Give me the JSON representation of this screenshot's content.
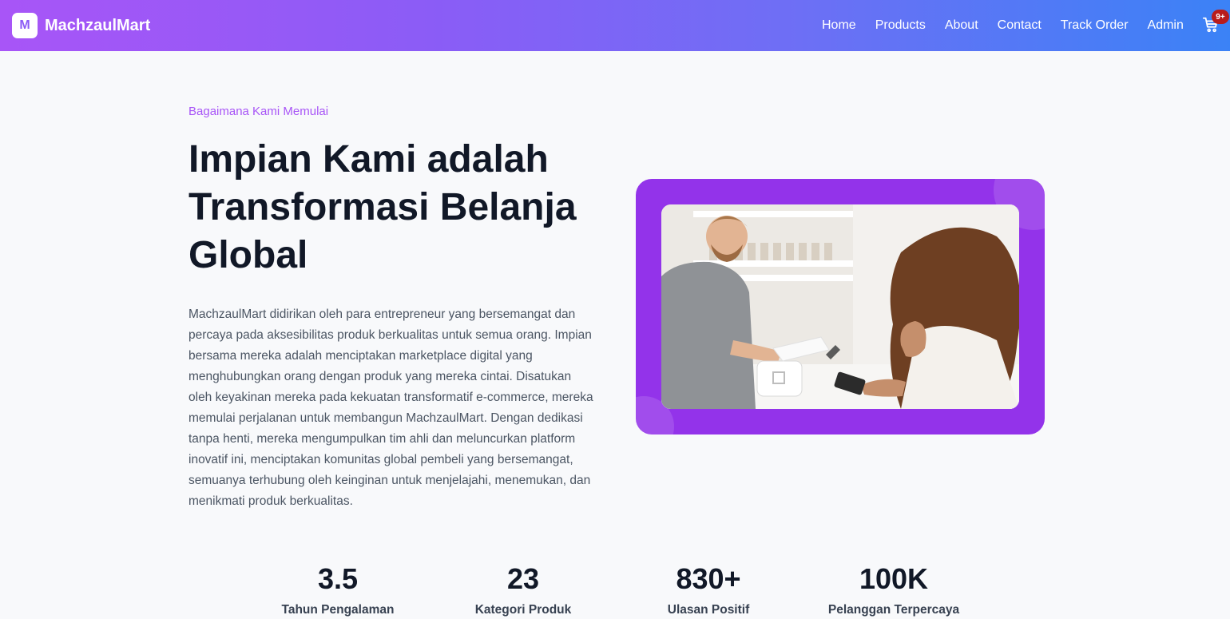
{
  "navbar": {
    "logo_letter": "M",
    "brand_name": "MachzaulMart",
    "links": [
      {
        "label": "Home"
      },
      {
        "label": "Products"
      },
      {
        "label": "About"
      },
      {
        "label": "Contact"
      },
      {
        "label": "Track Order"
      },
      {
        "label": "Admin"
      }
    ],
    "cart_icon": "cart-icon",
    "cart_badge": "9+"
  },
  "hero": {
    "eyebrow": "Bagaimana Kami Memulai",
    "headline": "Impian Kami adalah Transformasi Belanja Global",
    "body": "MachzaulMart didirikan oleh para entrepreneur yang bersemangat dan percaya pada aksesibilitas produk berkualitas untuk semua orang. Impian bersama mereka adalah menciptakan marketplace digital yang menghubungkan orang dengan produk yang mereka cintai. Disatukan oleh keyakinan mereka pada kekuatan transformatif e-commerce, mereka memulai perjalanan untuk membangun MachzaulMart. Dengan dedikasi tanpa henti, mereka mengumpulkan tim ahli dan meluncurkan platform inovatif ini, menciptakan komunitas global pembeli yang bersemangat, semuanya terhubung oleh keinginan untuk menjelajahi, menemukan, dan menikmati produk berkualitas."
  },
  "stats": [
    {
      "value": "3.5",
      "label": "Tahun Pengalaman"
    },
    {
      "value": "23",
      "label": "Kategori Produk"
    },
    {
      "value": "830+",
      "label": "Ulasan Positif"
    },
    {
      "value": "100K",
      "label": "Pelanggan Terpercaya"
    }
  ],
  "colors": {
    "nav_gradient_start": "#a855f7",
    "nav_gradient_end": "#3b82f6",
    "accent": "#a855f7",
    "frame": "#9333ea",
    "badge": "#b91c1c"
  }
}
